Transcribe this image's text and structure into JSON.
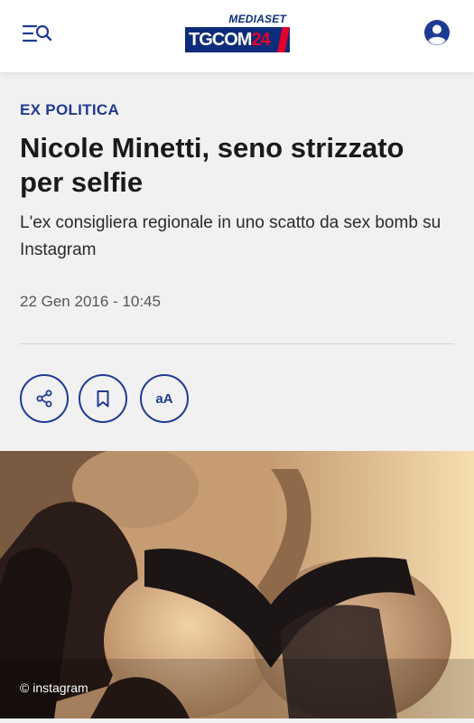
{
  "header": {
    "logo_top": "MEDIASET",
    "logo_main": "TGCOM",
    "logo_number": "24"
  },
  "article": {
    "category": "EX POLITICA",
    "title": "Nicole Minetti, seno strizzato per selfie",
    "subtitle": "L'ex consigliera regionale in uno scatto da sex bomb su Instagram",
    "date": "22 Gen 2016 - 10:45"
  },
  "actions": {
    "font_size_label": "aA"
  },
  "photo": {
    "credit": "© instagram"
  },
  "colors": {
    "accent": "#1f3a93",
    "brand_navy": "#0d2c7a",
    "brand_red": "#e4002b",
    "background": "#f1f1f1"
  },
  "icons": [
    "menu-search-icon",
    "user-icon",
    "share-icon",
    "bookmark-icon"
  ]
}
